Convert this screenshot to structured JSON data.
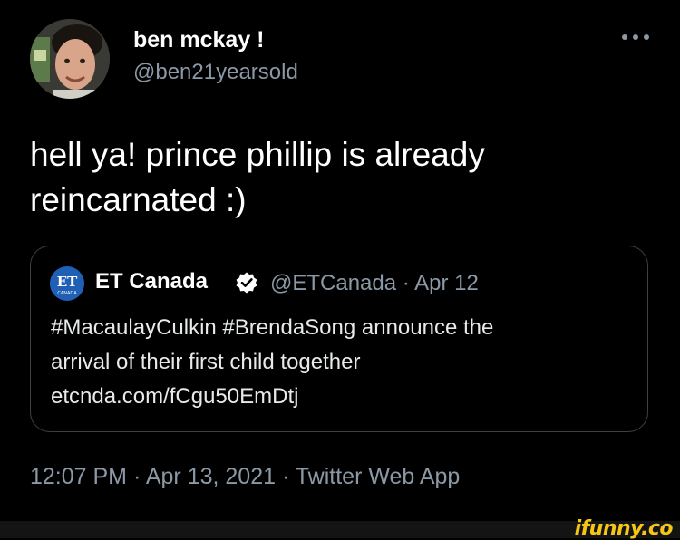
{
  "tweet": {
    "author": {
      "display_name": "ben mckay !",
      "handle": "@ben21yearsold",
      "avatar": "user-photo-avatar"
    },
    "more_icon": "more-dots-icon",
    "text_lines": [
      "hell ya! prince phillip is already",
      "reincarnated :)"
    ],
    "quoted": {
      "avatar": "et-canada-logo",
      "avatar_text": "ET",
      "avatar_subtext": "CANADA",
      "display_name": "ET Canada",
      "verified_icon": "verified-badge-icon",
      "meta": "@ETCanada · Apr 12",
      "text_lines": [
        "#MacaulayCulkin #BrendaSong announce the",
        "arrival of their first child together",
        "etcnda.com/fCgu50EmDtj"
      ]
    },
    "timestamp": "12:07 PM · Apr 13, 2021 · Twitter Web App"
  },
  "watermark": {
    "text": "ifunny.co"
  },
  "colors": {
    "background": "#000000",
    "primary_text": "#ffffff",
    "secondary_text": "#8b98a5",
    "quote_border": "#3c4043",
    "watermark": "#f5c518"
  }
}
